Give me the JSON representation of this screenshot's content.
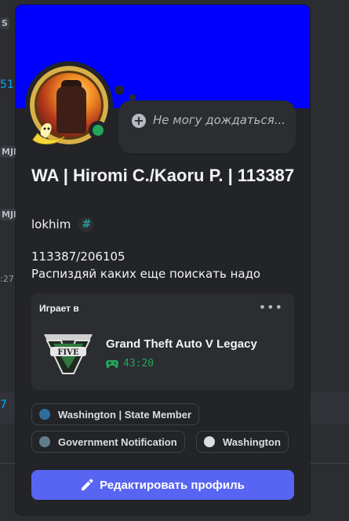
{
  "background": {
    "tag1": "S",
    "num1": "51",
    "tag2": "MJR",
    "tag3": "MJI",
    "small": ":27",
    "num2": "7"
  },
  "profile": {
    "banner_color": "#0000ff",
    "status": "online",
    "custom_status": "Не могу дождаться...",
    "display_name": "WA | Hiromi C./Kaoru P. | 113387",
    "username": "lokhim",
    "badge_symbol": "#",
    "bio_line1": "113387/206105",
    "bio_line2": "Распиздяй каких еще поискать надо"
  },
  "activity": {
    "header": "Играет в",
    "more_label": "•••",
    "game_name": "Grand Theft Auto V Legacy",
    "elapsed": "43:20",
    "icon": "gta-v-logo-icon"
  },
  "roles": [
    {
      "label": "Washington | State Member",
      "color": "#2e6e9e"
    },
    {
      "label": "Government Notification",
      "color": "#607d8b"
    },
    {
      "label": "Washington",
      "color": "#dbdee1"
    }
  ],
  "edit_button": {
    "label": "Редактировать профиль",
    "color": "#5865f2"
  }
}
